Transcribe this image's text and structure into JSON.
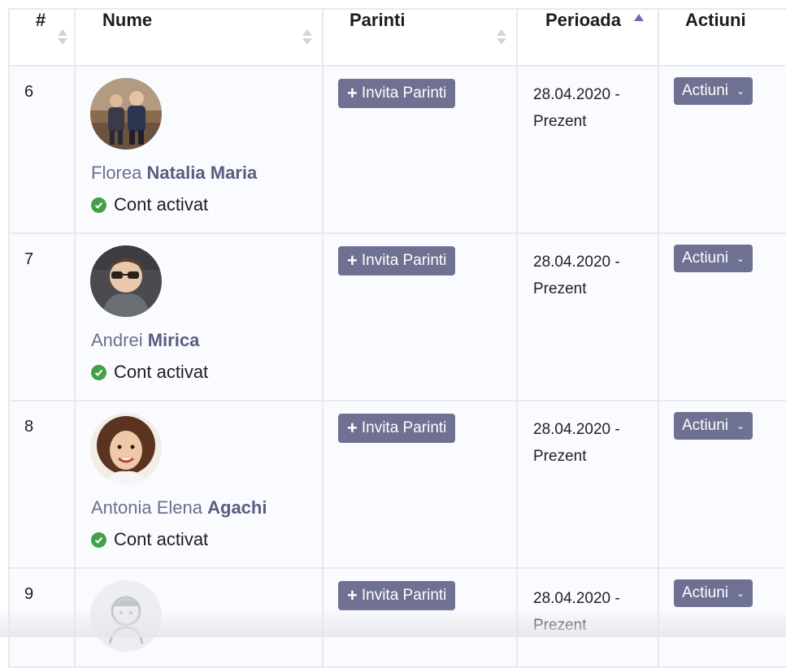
{
  "columns": {
    "num": "#",
    "name": "Nume",
    "parents": "Parinti",
    "period": "Perioada",
    "actions": "Actiuni"
  },
  "rows": [
    {
      "num": "6",
      "first_name": "Florea",
      "last_name": "Natalia Maria",
      "status": "Cont activat",
      "invite_label": "Invita Parinti",
      "period_start": "28.04.2020 -",
      "period_end": "Prezent",
      "actions_label": "Actiuni"
    },
    {
      "num": "7",
      "first_name": "Andrei",
      "last_name": "Mirica",
      "status": "Cont activat",
      "invite_label": "Invita Parinti",
      "period_start": "28.04.2020 -",
      "period_end": "Prezent",
      "actions_label": "Actiuni"
    },
    {
      "num": "8",
      "first_name": "Antonia Elena",
      "last_name": "Agachi",
      "status": "Cont activat",
      "invite_label": "Invita Parinti",
      "period_start": "28.04.2020 -",
      "period_end": "Prezent",
      "actions_label": "Actiuni"
    },
    {
      "num": "9",
      "first_name": "",
      "last_name": "",
      "status": "",
      "invite_label": "Invita Parinti",
      "period_start": "28.04.2020 -",
      "period_end": "Prezent",
      "actions_label": "Actiuni"
    }
  ],
  "colors": {
    "button_bg": "#6e7191",
    "name_color": "#6d6f8f",
    "status_check": "#43a047",
    "sort_active": "#6770b9"
  },
  "icons": {
    "sort": "sort-both-icon",
    "sort_asc": "sort-asc-icon",
    "plus": "plus-icon",
    "check": "check-circle-icon",
    "chevron": "chevron-down-icon"
  }
}
